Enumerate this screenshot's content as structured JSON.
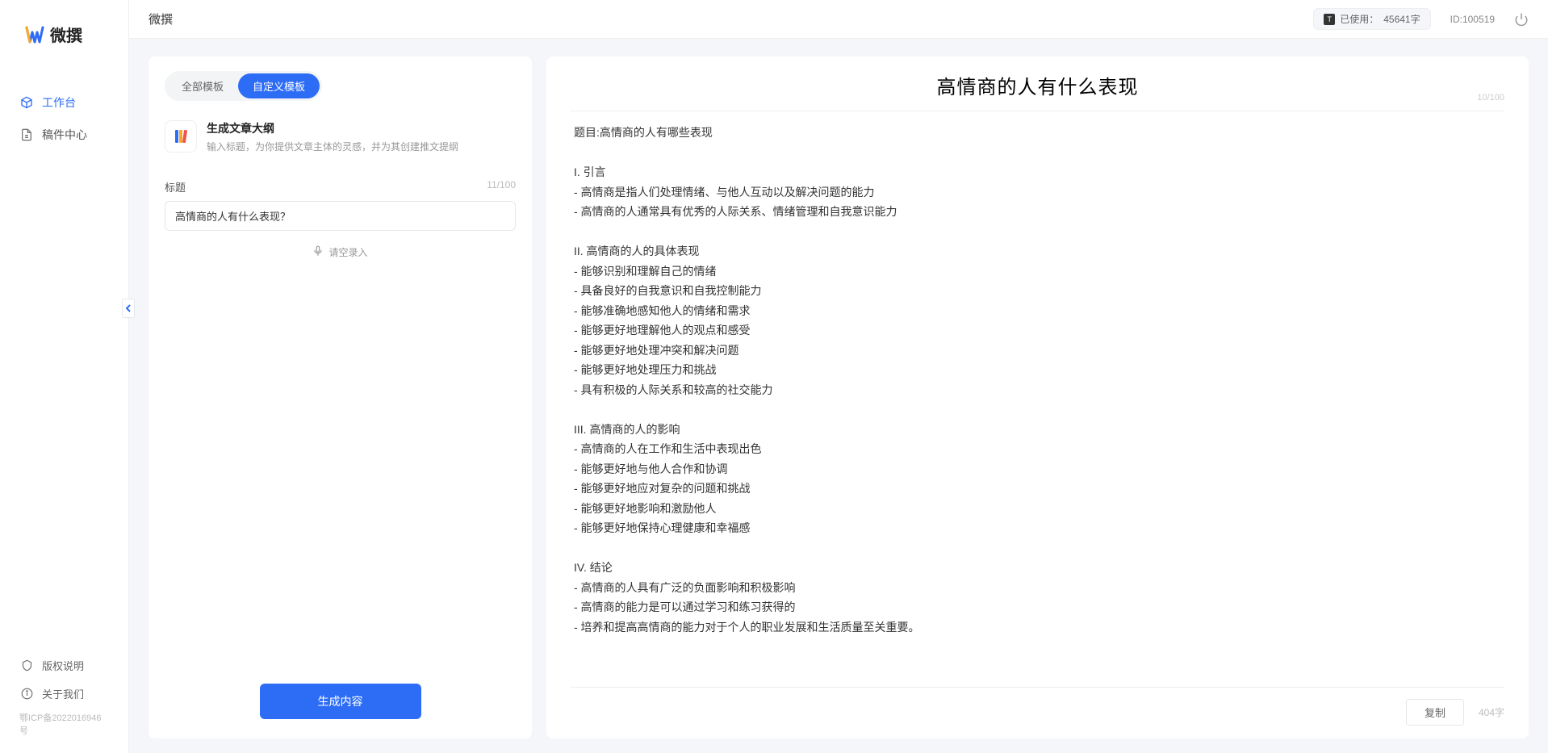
{
  "app_name": "微撰",
  "logo_text": "微撰",
  "sidebar": {
    "items": [
      {
        "label": "工作台"
      },
      {
        "label": "稿件中心"
      }
    ],
    "footer": [
      {
        "label": "版权说明"
      },
      {
        "label": "关于我们"
      }
    ],
    "icp": "鄂ICP备2022016946号"
  },
  "topbar": {
    "usage_prefix": "已使用：",
    "usage_value": "45641字",
    "user_id": "ID:100519"
  },
  "tabs": {
    "all": "全部模板",
    "custom": "自定义模板"
  },
  "template": {
    "title": "生成文章大纲",
    "desc": "输入标题，为你提供文章主体的灵感，并为其创建推文提纲"
  },
  "field": {
    "label": "标题",
    "count": "11/100",
    "value": "高情商的人有什么表现？"
  },
  "voice_label": "请空录入",
  "generate_button": "生成内容",
  "output": {
    "title": "高情商的人有什么表现",
    "title_count": "10/100",
    "body": "题目:高情商的人有哪些表现\n\nI. 引言\n- 高情商是指人们处理情绪、与他人互动以及解决问题的能力\n- 高情商的人通常具有优秀的人际关系、情绪管理和自我意识能力\n\nII. 高情商的人的具体表现\n- 能够识别和理解自己的情绪\n- 具备良好的自我意识和自我控制能力\n- 能够准确地感知他人的情绪和需求\n- 能够更好地理解他人的观点和感受\n- 能够更好地处理冲突和解决问题\n- 能够更好地处理压力和挑战\n- 具有积极的人际关系和较高的社交能力\n\nIII. 高情商的人的影响\n- 高情商的人在工作和生活中表现出色\n- 能够更好地与他人合作和协调\n- 能够更好地应对复杂的问题和挑战\n- 能够更好地影响和激励他人\n- 能够更好地保持心理健康和幸福感\n\nIV. 结论\n- 高情商的人具有广泛的负面影响和积极影响\n- 高情商的能力是可以通过学习和练习获得的\n- 培养和提高高情商的能力对于个人的职业发展和生活质量至关重要。",
    "copy_label": "复制",
    "word_count": "404字"
  }
}
